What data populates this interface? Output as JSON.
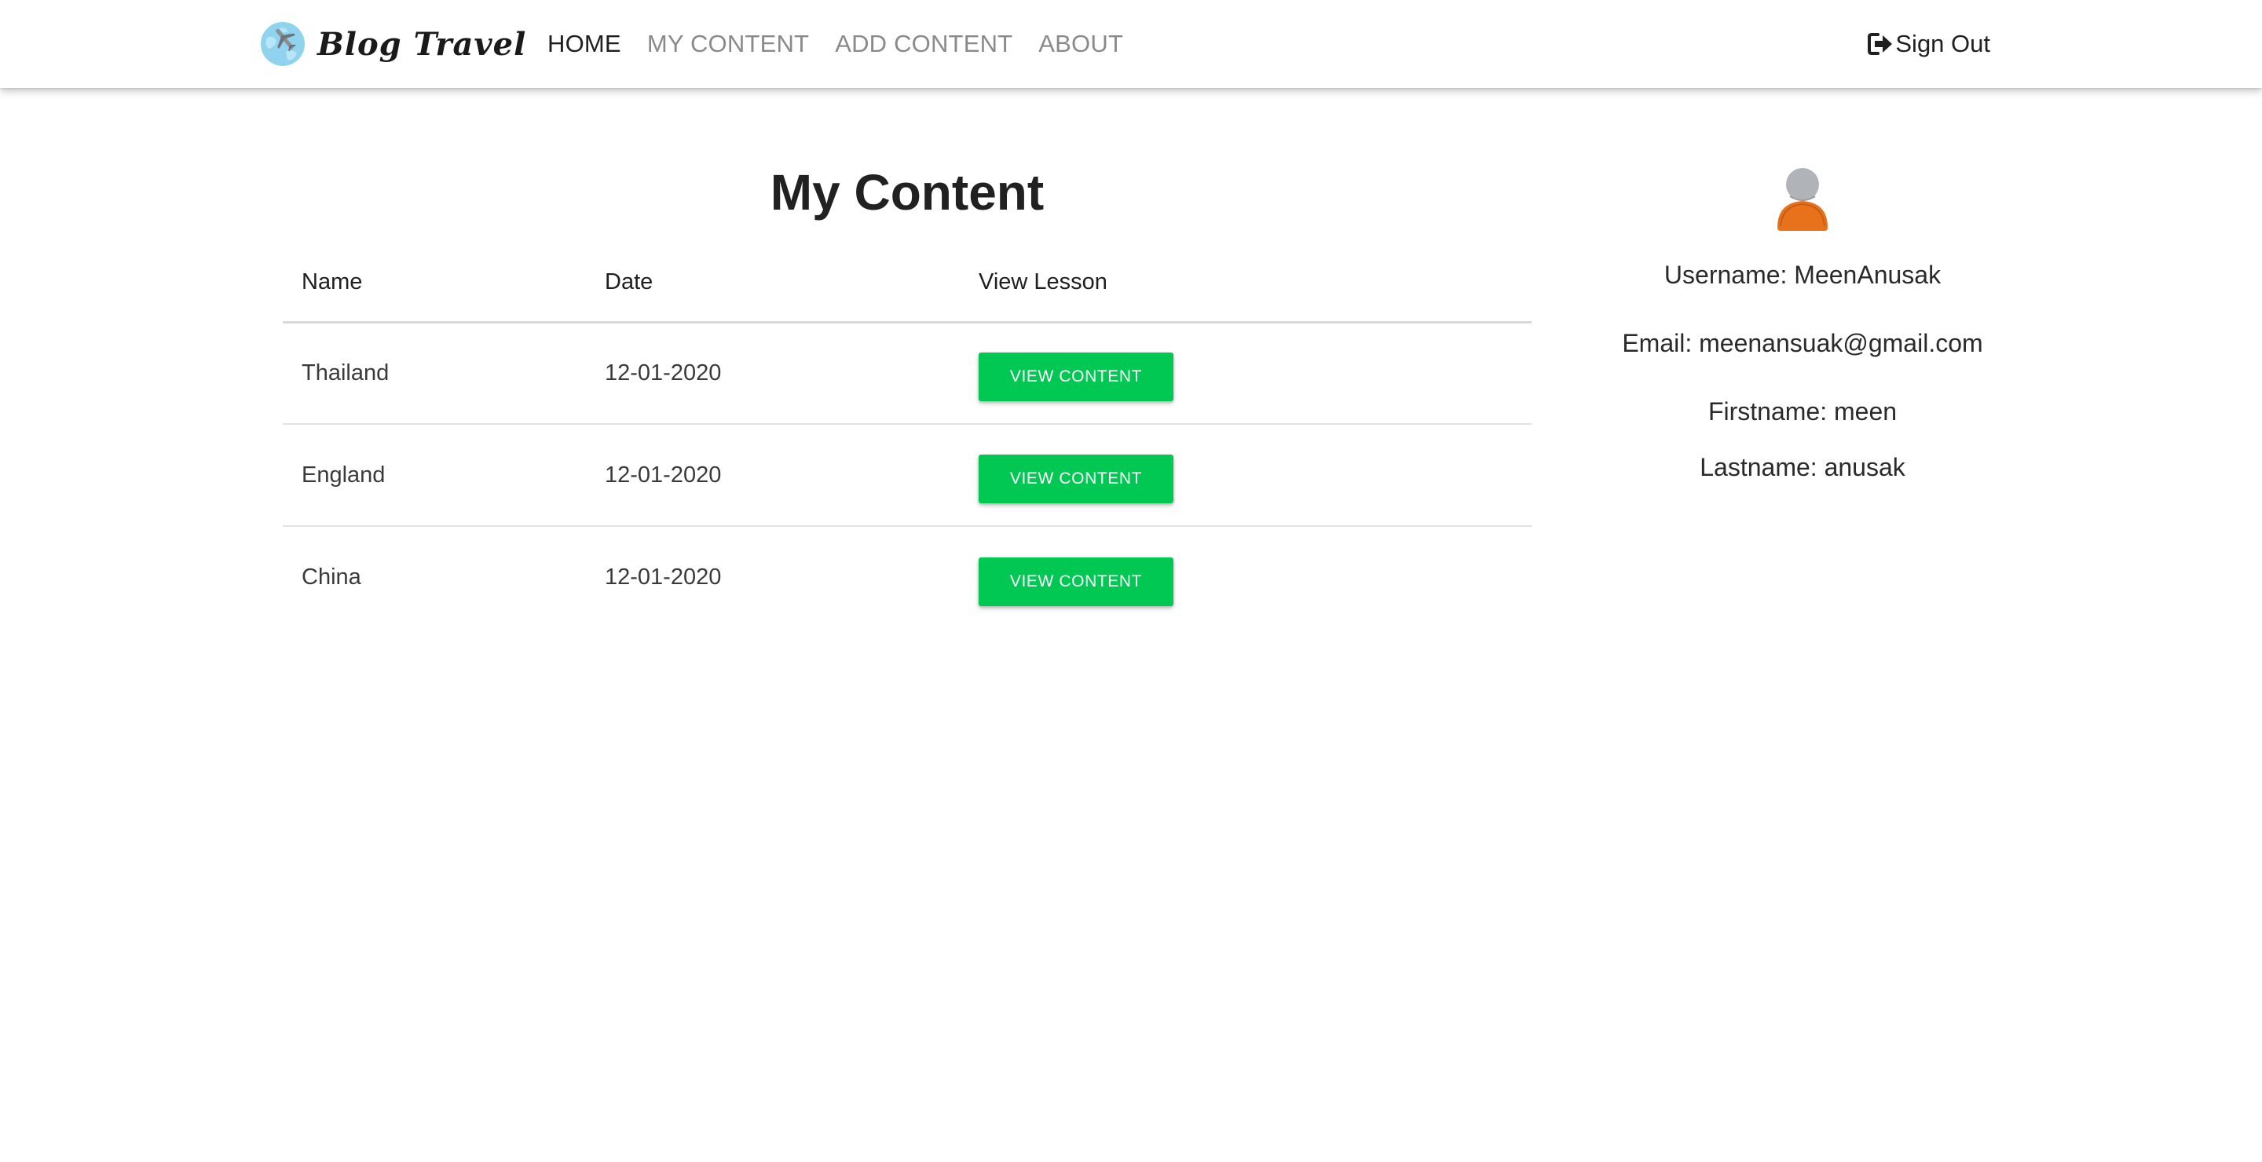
{
  "nav": {
    "brand": "Blog Travel",
    "brand_logo_icon": "globe-airplane-logo",
    "links": [
      {
        "label": "HOME",
        "active": true
      },
      {
        "label": "MY CONTENT",
        "active": false
      },
      {
        "label": "ADD CONTENT",
        "active": false
      },
      {
        "label": "ABOUT",
        "active": false
      }
    ],
    "signout_label": "Sign Out",
    "signout_icon": "sign-out-icon"
  },
  "main": {
    "title": "My Content",
    "table": {
      "headers": [
        "Name",
        "Date",
        "View Lesson"
      ],
      "rows": [
        {
          "name": "Thailand",
          "date": "12-01-2020",
          "button": "VIEW CONTENT"
        },
        {
          "name": "England",
          "date": "12-01-2020",
          "button": "VIEW CONTENT"
        },
        {
          "name": "China",
          "date": "12-01-2020",
          "button": "VIEW CONTENT"
        }
      ]
    }
  },
  "profile": {
    "avatar_icon": "user-avatar-icon",
    "username": "Username: MeenAnusak",
    "email": "Email: meenansuak@gmail.com",
    "firstname": "Firstname: meen",
    "lastname": "Lastname: anusak"
  },
  "colors": {
    "button": "#00c853",
    "nav_active": "#1f1f1f",
    "nav_inactive": "#8a8a8a",
    "avatar_body": "#e8721c",
    "avatar_head": "#b0b4b8"
  }
}
